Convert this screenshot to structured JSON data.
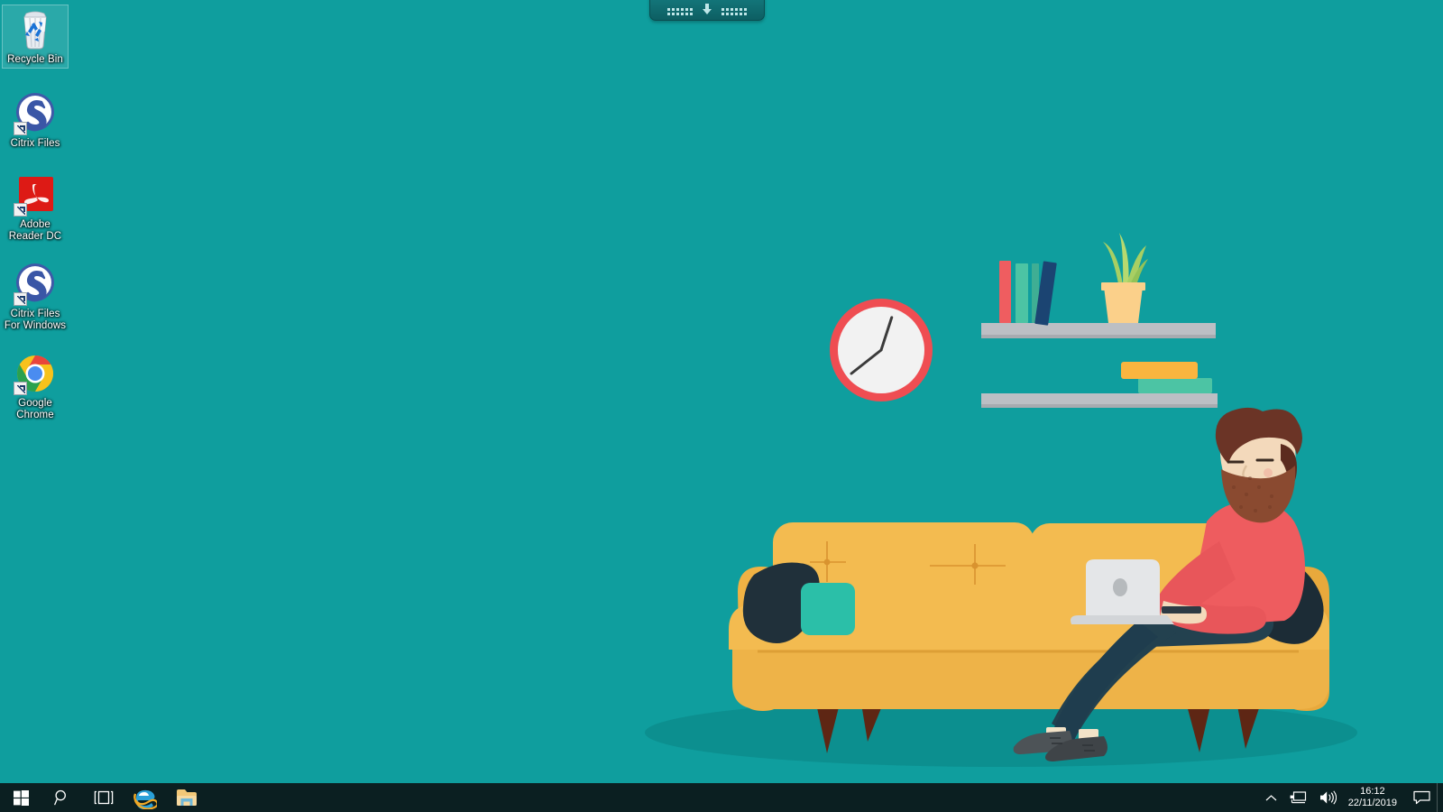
{
  "desktop": {
    "background_color": "#0f9e9e",
    "wallpaper_name": "man-working-on-laptop-on-couch-illustration"
  },
  "connection_bar": {
    "name": "remote-session-connection-bar",
    "pin_icon": "pin-down-arrow-icon",
    "grip_left": "drag-grip-dots",
    "grip_right": "drag-grip-dots"
  },
  "icons": [
    {
      "label": "Recycle Bin",
      "icon": "recycle-bin-icon",
      "shortcut": false,
      "selected": true
    },
    {
      "label": "Citrix Files",
      "icon": "citrix-files-icon",
      "shortcut": true,
      "selected": false
    },
    {
      "label": "Adobe\nReader DC",
      "icon": "adobe-reader-dc-icon",
      "shortcut": true,
      "selected": false
    },
    {
      "label": "Citrix Files\nFor Windows",
      "icon": "citrix-files-for-windows-icon",
      "shortcut": true,
      "selected": false
    },
    {
      "label": "Google\nChrome",
      "icon": "google-chrome-icon",
      "shortcut": true,
      "selected": false
    }
  ],
  "taskbar": {
    "background_color": "#0b1f21",
    "buttons": [
      {
        "name": "start-button",
        "icon": "windows-logo-icon"
      },
      {
        "name": "search-button",
        "icon": "search-icon"
      },
      {
        "name": "task-view-button",
        "icon": "task-view-icon"
      },
      {
        "name": "internet-explorer-button",
        "icon": "internet-explorer-icon"
      },
      {
        "name": "file-explorer-button",
        "icon": "file-explorer-icon"
      }
    ],
    "tray": {
      "show_hidden_icons": "chevron-up-icon",
      "network": "network-icon",
      "volume": "speaker-icon",
      "time": "16:12",
      "date": "22/11/2019",
      "action_center": "action-center-icon",
      "show_desktop": "show-desktop-button"
    }
  },
  "illustration": {
    "colors": {
      "background": "#0f9e9e",
      "floor_shadow": "#0c8f8f",
      "couch_main": "#f0b244",
      "couch_light": "#f6c65f",
      "couch_seat": "#eaa93c",
      "couch_leg": "#6b2b18",
      "clock_rim": "#ef4d52",
      "clock_face": "#f2f2f2",
      "clock_hand": "#3b3b3b",
      "shelf": "#bcbfc4",
      "book_red": "#ef5d60",
      "book_teal": "#4cc4a4",
      "book_navy": "#1b4472",
      "book_orange": "#f9b53f",
      "book_green": "#4cc4a4",
      "plant_leaf": "#a8cf63",
      "plant_pot": "#fbd08a",
      "pillow_dark": "#20303a",
      "pillow_teal": "#2bbfa8",
      "shirt": "#ee5c5f",
      "pants": "#1f3d4e",
      "skin": "#f5dcc2",
      "hair": "#6b3426",
      "beard": "#8a4a30",
      "shoe": "#4d5357",
      "laptop": "#e4e6e8"
    },
    "objects": [
      "wall-clock",
      "upper-shelf",
      "lower-shelf",
      "books",
      "potted-plant",
      "couch",
      "pillows",
      "man",
      "laptop",
      "floor-shadow"
    ]
  }
}
